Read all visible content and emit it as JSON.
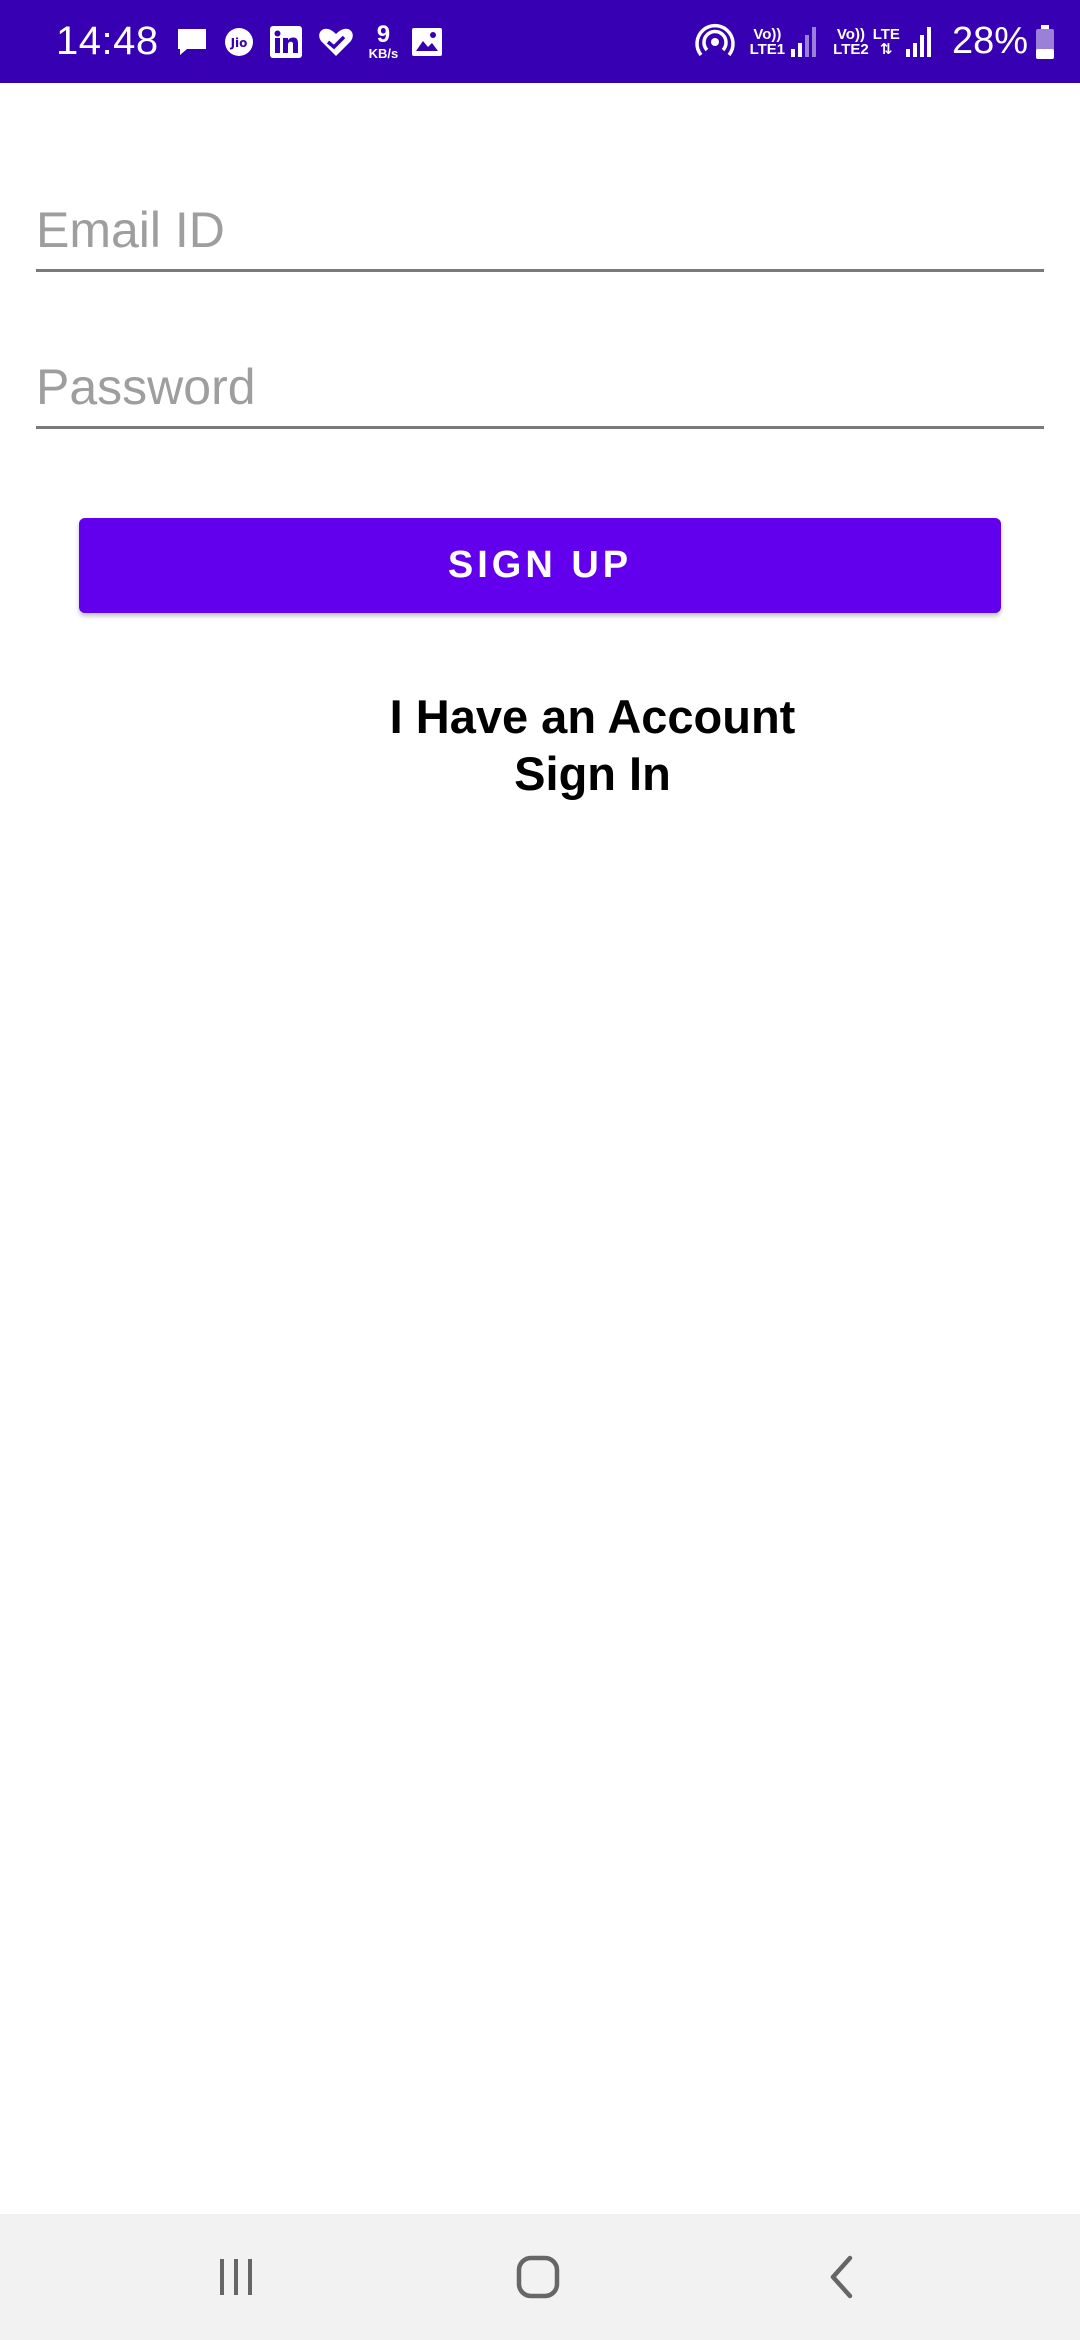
{
  "status_bar": {
    "time": "14:48",
    "net_speed_value": "9",
    "net_speed_unit": "KB/s",
    "sim1_top": "Vo))",
    "sim1_bottom": "LTE1",
    "sim2_top": "Vo))",
    "sim2_bottom": "LTE2",
    "sim2_type": "LTE",
    "battery": "28%",
    "notification_icons": [
      "message-icon",
      "jio-icon",
      "linkedin-icon",
      "health-icon",
      "image-icon"
    ],
    "system_icons": [
      "hotspot-icon",
      "signal-icon",
      "battery-icon"
    ],
    "background_color": "#3700b3"
  },
  "form": {
    "email_placeholder": "Email ID",
    "email_value": "",
    "password_placeholder": "Password",
    "password_value": ""
  },
  "signup_button": {
    "label": "SIGN UP",
    "color": "#6200ee"
  },
  "account_link": {
    "line1": "I Have an Account",
    "line2": "Sign In"
  },
  "nav_bar": {
    "icons": [
      "recents-icon",
      "home-icon",
      "back-icon"
    ]
  }
}
